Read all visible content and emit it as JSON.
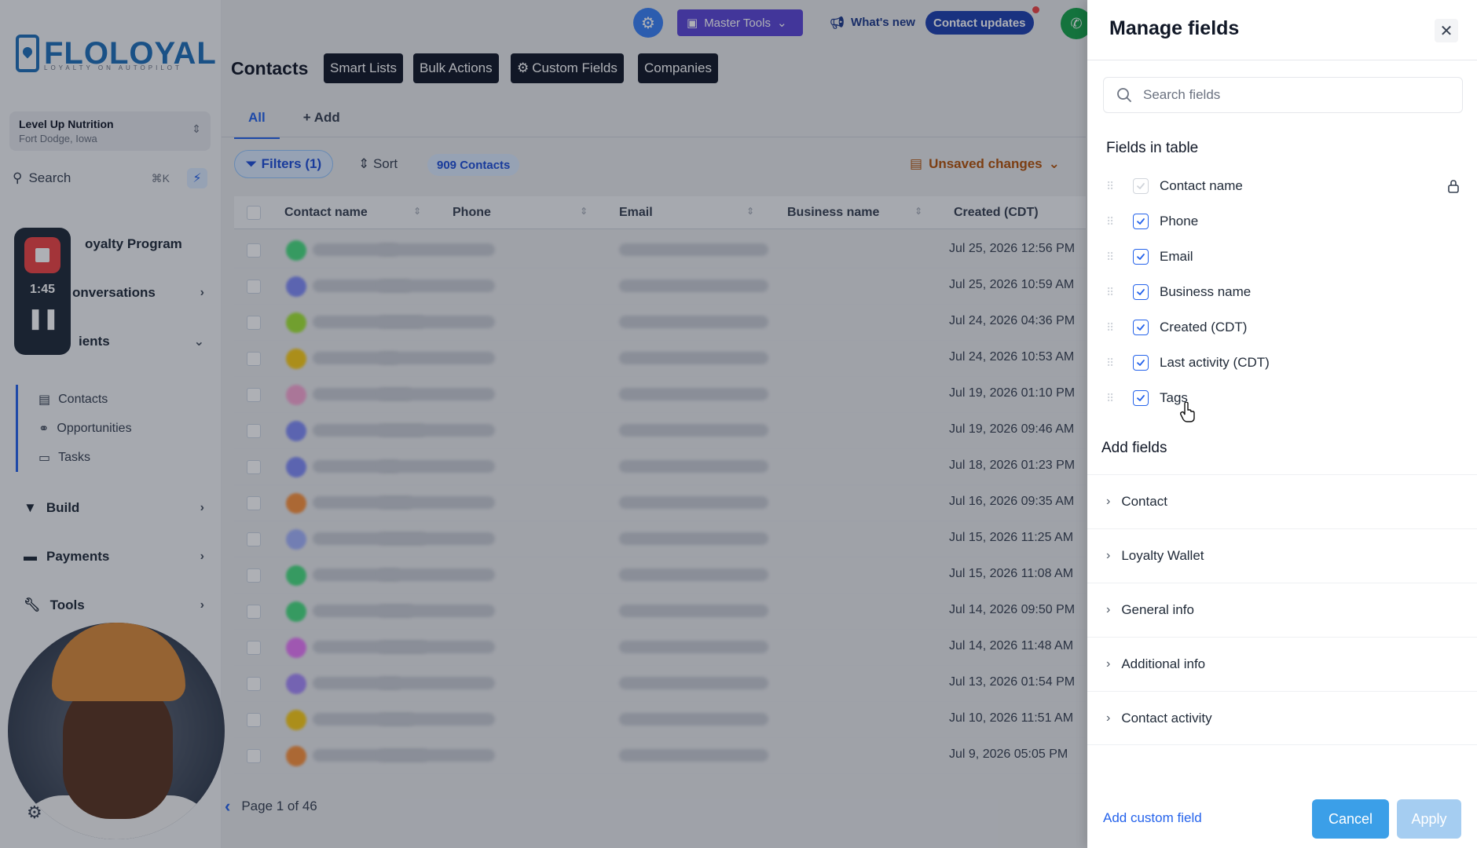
{
  "brand": {
    "logo_text": "FLOLOYAL",
    "logo_sub": "LOYALTY ON AUTOPILOT"
  },
  "account": {
    "name": "Level Up Nutrition",
    "location": "Fort Dodge, Iowa"
  },
  "sidebar": {
    "search_label": "Search",
    "search_shortcut": "⌘K",
    "nav": [
      {
        "label": "oyalty Program"
      },
      {
        "label": "onversations"
      },
      {
        "label": "ients"
      }
    ],
    "sub_items": [
      {
        "label": "Contacts"
      },
      {
        "label": "Opportunities"
      },
      {
        "label": "Tasks"
      }
    ],
    "bottom_nav": [
      {
        "label": "Build"
      },
      {
        "label": "Payments"
      },
      {
        "label": "Tools"
      }
    ]
  },
  "recorder": {
    "time": "1:45"
  },
  "topbar": {
    "master_tools": "Master Tools",
    "whats_new": "What's new",
    "contact_updates": "Contact updates"
  },
  "page": {
    "title": "Contacts",
    "tabs": [
      "Smart Lists",
      "Bulk Actions",
      "Custom Fields",
      "Companies"
    ],
    "view_tabs": {
      "all": "All",
      "add": "Add"
    },
    "filters_label": "Filters (1)",
    "sort_label": "Sort",
    "count_label": "909 Contacts",
    "unsaved_label": "Unsaved changes"
  },
  "table": {
    "columns": [
      "Contact name",
      "Phone",
      "Email",
      "Business name",
      "Created (CDT)"
    ],
    "rows": [
      {
        "created": "Jul 25, 2026 12:56 PM",
        "color": "#4ade80"
      },
      {
        "created": "Jul 25, 2026 10:59 AM",
        "color": "#818cf8"
      },
      {
        "created": "Jul 24, 2026 04:36 PM",
        "color": "#a3e635"
      },
      {
        "created": "Jul 24, 2026 10:53 AM",
        "color": "#facc15"
      },
      {
        "created": "Jul 19, 2026 01:10 PM",
        "color": "#f9a8d4"
      },
      {
        "created": "Jul 19, 2026 09:46 AM",
        "color": "#818cf8"
      },
      {
        "created": "Jul 18, 2026 01:23 PM",
        "color": "#818cf8"
      },
      {
        "created": "Jul 16, 2026 09:35 AM",
        "color": "#fb923c"
      },
      {
        "created": "Jul 15, 2026 11:25 AM",
        "color": "#a5b4fc"
      },
      {
        "created": "Jul 15, 2026 11:08 AM",
        "color": "#4ade80"
      },
      {
        "created": "Jul 14, 2026 09:50 PM",
        "color": "#4ade80"
      },
      {
        "created": "Jul 14, 2026 11:48 AM",
        "color": "#e879f9"
      },
      {
        "created": "Jul 13, 2026 01:54 PM",
        "color": "#a78bfa"
      },
      {
        "created": "Jul 10, 2026 11:51 AM",
        "color": "#facc15"
      },
      {
        "created": "Jul 9, 2026 05:05 PM",
        "color": "#fb923c"
      }
    ],
    "pager_text": "Page 1 of 46"
  },
  "panel": {
    "title": "Manage fields",
    "search_placeholder": "Search fields",
    "fields_in_table_heading": "Fields in table",
    "fields": [
      {
        "label": "Contact name",
        "checked": true,
        "locked": true
      },
      {
        "label": "Phone",
        "checked": true,
        "locked": false
      },
      {
        "label": "Email",
        "checked": true,
        "locked": false
      },
      {
        "label": "Business name",
        "checked": true,
        "locked": false
      },
      {
        "label": "Created (CDT)",
        "checked": true,
        "locked": false
      },
      {
        "label": "Last activity (CDT)",
        "checked": true,
        "locked": false
      },
      {
        "label": "Tags",
        "checked": true,
        "locked": false
      }
    ],
    "add_fields_heading": "Add fields",
    "groups": [
      "Contact",
      "Loyalty Wallet",
      "General info",
      "Additional info",
      "Contact activity"
    ],
    "add_custom_field": "Add custom field",
    "cancel": "Cancel",
    "apply": "Apply"
  },
  "colors": {
    "accent": "#2563eb",
    "cancel_bg": "#3b9fe8",
    "apply_bg": "#a5cdf1",
    "brand": "#1f6fb8"
  }
}
